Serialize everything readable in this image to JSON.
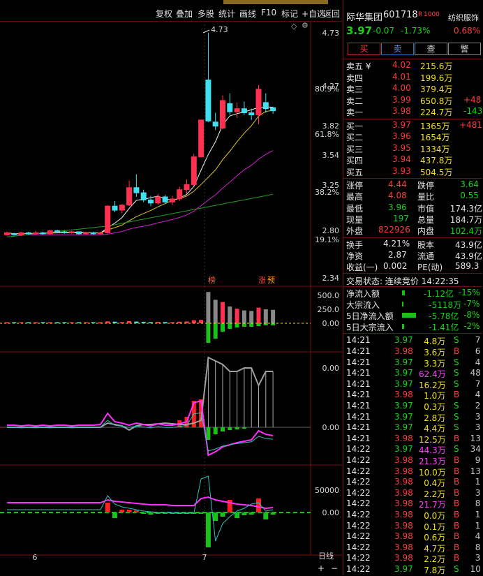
{
  "toolbar": {
    "items": [
      "复权",
      "叠加",
      "多股",
      "统计",
      "画线",
      "F10",
      "标记",
      "+自选",
      "返回"
    ]
  },
  "stock": {
    "name": "际华集团",
    "code": "601718",
    "badge": "R",
    "sector": "纺织服饰",
    "price": "3.97",
    "change": "-0.07",
    "change_pct": "-1.73%",
    "sector_pct": "0.68%"
  },
  "buttons": [
    "买",
    "卖",
    "查",
    "警"
  ],
  "chart_axis": {
    "price_ticks": [
      "4.73",
      "4.27",
      "3.82",
      "3.54",
      "3.25",
      "2.80",
      "2.34"
    ],
    "pct_ticks": [
      "80.9%",
      "61.8%",
      "38.2%",
      "19.1%"
    ],
    "peak_label": "4.73",
    "vol_ticks": [
      "500.0",
      "250.0",
      "0.00"
    ],
    "ind1_ticks": [
      "0.00",
      "0.00"
    ],
    "ind2_ticks": [
      "50000",
      "0.00"
    ],
    "dates": [
      "6",
      "7"
    ],
    "period": "日线",
    "tags": [
      "榜",
      "涨",
      "预"
    ]
  },
  "sell_orders": [
    {
      "label": "卖五 ¥",
      "price": "4.02",
      "vol": "215.6万",
      "delta": ""
    },
    {
      "label": "卖四",
      "price": "4.01",
      "vol": "199.6万",
      "delta": ""
    },
    {
      "label": "卖三",
      "price": "4.00",
      "vol": "379.4万",
      "delta": ""
    },
    {
      "label": "卖二",
      "price": "3.99",
      "vol": "650.8万",
      "delta": "+48"
    },
    {
      "label": "卖一",
      "price": "3.98",
      "vol": "224.7万",
      "delta": "-143"
    }
  ],
  "buy_orders": [
    {
      "label": "买一",
      "price": "3.97",
      "vol": "1365万",
      "delta": "+481"
    },
    {
      "label": "买二",
      "price": "3.96",
      "vol": "1654万",
      "delta": ""
    },
    {
      "label": "买三",
      "price": "3.95",
      "vol": "1334万",
      "delta": ""
    },
    {
      "label": "买四",
      "price": "3.94",
      "vol": "437.8万",
      "delta": ""
    },
    {
      "label": "买五",
      "price": "3.93",
      "vol": "504.5万",
      "delta": ""
    }
  ],
  "stats": [
    {
      "l1": "涨停",
      "v1": "4.44",
      "l2": "跌停",
      "v2": "3.64",
      "c1": "red",
      "c2": "green"
    },
    {
      "l1": "最高",
      "v1": "4.08",
      "l2": "量比",
      "v2": "0.55",
      "c1": "red",
      "c2": "green"
    },
    {
      "l1": "最低",
      "v1": "3.96",
      "l2": "市值",
      "v2": "174.3亿",
      "c1": "green",
      "c2": "white"
    },
    {
      "l1": "现量",
      "v1": "197",
      "l2": "总量",
      "v2": "184.7万",
      "c1": "green",
      "c2": "white"
    },
    {
      "l1": "外盘",
      "v1": "822926",
      "l2": "内盘",
      "v2": "102.4万",
      "c1": "red",
      "c2": "green"
    }
  ],
  "stats2": [
    {
      "l1": "换手",
      "v1": "4.21%",
      "l2": "股本",
      "v2": "43.9亿"
    },
    {
      "l1": "净资",
      "v1": "2.87",
      "l2": "流通",
      "v2": "43.9亿"
    },
    {
      "l1": "收益(一)",
      "v1": "0.002",
      "l2": "PE(动)",
      "v2": "589.3"
    }
  ],
  "trade_status": "交易状态: 连续竞价 14:22:35",
  "flows": [
    {
      "label": "净流入额",
      "v": "-1.12亿",
      "p": "-15%",
      "bar": 4
    },
    {
      "label": "大宗流入",
      "v": "-5118万",
      "p": "-7%",
      "bar": 2
    },
    {
      "label": "5日净流入额",
      "v": "-5.78亿",
      "p": "-8%",
      "bar": 20
    },
    {
      "label": "5日大宗流入",
      "v": "-1.41亿",
      "p": "-2%",
      "bar": 3
    }
  ],
  "ticks": [
    {
      "t": "14:21",
      "p": "3.97",
      "v": "4.8万",
      "s": "S",
      "n": "7",
      "vc": "yellow"
    },
    {
      "t": "14:21",
      "p": "3.98",
      "v": "3.6万",
      "s": "B",
      "n": "6",
      "vc": "yellow"
    },
    {
      "t": "14:21",
      "p": "3.97",
      "v": "3.3万",
      "s": "S",
      "n": "4",
      "vc": "yellow"
    },
    {
      "t": "14:21",
      "p": "3.97",
      "v": "62.4万",
      "s": "S",
      "n": "48",
      "vc": "mag"
    },
    {
      "t": "14:21",
      "p": "3.97",
      "v": "16.2万",
      "s": "S",
      "n": "7",
      "vc": "yellow"
    },
    {
      "t": "14:21",
      "p": "3.98",
      "v": "1.0万",
      "s": "B",
      "n": "4",
      "vc": "yellow"
    },
    {
      "t": "14:21",
      "p": "3.97",
      "v": "0.3万",
      "s": "S",
      "n": "2",
      "vc": "yellow"
    },
    {
      "t": "14:21",
      "p": "3.97",
      "v": "2.8万",
      "s": "S",
      "n": "3",
      "vc": "yellow"
    },
    {
      "t": "14:21",
      "p": "3.97",
      "v": "4.4万",
      "s": "S",
      "n": "3",
      "vc": "yellow"
    },
    {
      "t": "14:21",
      "p": "3.98",
      "v": "12.5万",
      "s": "B",
      "n": "13",
      "vc": "yellow"
    },
    {
      "t": "14:22",
      "p": "3.97",
      "v": "44.3万",
      "s": "S",
      "n": "34",
      "vc": "mag"
    },
    {
      "t": "14:22",
      "p": "3.98",
      "v": "21.3万",
      "s": "B",
      "n": "9",
      "vc": "mag"
    },
    {
      "t": "14:22",
      "p": "3.98",
      "v": "10.0万",
      "s": "B",
      "n": "13",
      "vc": "yellow"
    },
    {
      "t": "14:22",
      "p": "3.98",
      "v": "0.4万",
      "s": "B",
      "n": "1",
      "vc": "yellow"
    },
    {
      "t": "14:22",
      "p": "3.98",
      "v": "2.2万",
      "s": "B",
      "n": "3",
      "vc": "yellow"
    },
    {
      "t": "14:22",
      "p": "3.98",
      "v": "21.7万",
      "s": "B",
      "n": "8",
      "vc": "mag"
    },
    {
      "t": "14:22",
      "p": "3.98",
      "v": "0.0万",
      "s": "B",
      "n": "1",
      "vc": "yellow"
    },
    {
      "t": "14:22",
      "p": "3.98",
      "v": "0.1万",
      "s": "B",
      "n": "1",
      "vc": "yellow"
    },
    {
      "t": "14:22",
      "p": "3.98",
      "v": "0.6万",
      "s": "B",
      "n": "4",
      "vc": "yellow"
    },
    {
      "t": "14:22",
      "p": "3.98",
      "v": "4.7万",
      "s": "B",
      "n": "8",
      "vc": "yellow"
    },
    {
      "t": "14:22",
      "p": "3.98",
      "v": "2.2万",
      "s": "B",
      "n": "3",
      "vc": "yellow"
    },
    {
      "t": "14:22",
      "p": "3.97",
      "v": "7.8万",
      "s": "S",
      "n": "10",
      "vc": "yellow"
    }
  ],
  "candles": [
    {
      "o": 2.76,
      "c": 2.78,
      "h": 2.79,
      "l": 2.75
    },
    {
      "o": 2.77,
      "c": 2.76,
      "h": 2.78,
      "l": 2.75
    },
    {
      "o": 2.76,
      "c": 2.78,
      "h": 2.79,
      "l": 2.75
    },
    {
      "o": 2.78,
      "c": 2.77,
      "h": 2.79,
      "l": 2.76
    },
    {
      "o": 2.77,
      "c": 2.78,
      "h": 2.8,
      "l": 2.76
    },
    {
      "o": 2.78,
      "c": 2.77,
      "h": 2.79,
      "l": 2.76
    },
    {
      "o": 2.77,
      "c": 2.8,
      "h": 2.81,
      "l": 2.76
    },
    {
      "o": 2.8,
      "c": 2.79,
      "h": 2.81,
      "l": 2.78
    },
    {
      "o": 2.79,
      "c": 2.78,
      "h": 2.8,
      "l": 2.77
    },
    {
      "o": 2.78,
      "c": 2.79,
      "h": 2.8,
      "l": 2.77
    },
    {
      "o": 2.79,
      "c": 2.77,
      "h": 2.79,
      "l": 2.76
    },
    {
      "o": 2.77,
      "c": 2.78,
      "h": 2.79,
      "l": 2.76
    },
    {
      "o": 2.78,
      "c": 2.77,
      "h": 2.79,
      "l": 2.76
    },
    {
      "o": 2.77,
      "c": 2.78,
      "h": 2.79,
      "l": 2.76
    },
    {
      "o": 2.78,
      "c": 3.04,
      "h": 3.05,
      "l": 2.77
    },
    {
      "o": 3.04,
      "c": 3.0,
      "h": 3.09,
      "l": 2.98
    },
    {
      "o": 3.0,
      "c": 3.05,
      "h": 3.06,
      "l": 2.97
    },
    {
      "o": 3.05,
      "c": 3.22,
      "h": 3.29,
      "l": 3.04
    },
    {
      "o": 3.22,
      "c": 3.17,
      "h": 3.35,
      "l": 3.13
    },
    {
      "o": 3.17,
      "c": 3.1,
      "h": 3.2,
      "l": 3.08
    },
    {
      "o": 3.1,
      "c": 3.07,
      "h": 3.14,
      "l": 3.04
    },
    {
      "o": 3.07,
      "c": 3.13,
      "h": 3.16,
      "l": 3.05
    },
    {
      "o": 3.13,
      "c": 3.08,
      "h": 3.15,
      "l": 3.06
    },
    {
      "o": 3.08,
      "c": 3.11,
      "h": 3.14,
      "l": 3.05
    },
    {
      "o": 3.11,
      "c": 3.2,
      "h": 3.23,
      "l": 3.09
    },
    {
      "o": 3.2,
      "c": 3.25,
      "h": 3.3,
      "l": 3.16
    },
    {
      "o": 3.25,
      "c": 3.52,
      "h": 3.55,
      "l": 3.24
    },
    {
      "o": 3.52,
      "c": 3.88,
      "h": 3.88,
      "l": 3.88
    },
    {
      "o": 4.27,
      "c": 3.87,
      "h": 4.73,
      "l": 3.86
    },
    {
      "o": 3.86,
      "c": 3.82,
      "h": 3.95,
      "l": 3.78
    },
    {
      "o": 3.8,
      "c": 4.07,
      "h": 4.12,
      "l": 3.79
    },
    {
      "o": 4.04,
      "c": 3.96,
      "h": 4.14,
      "l": 3.93
    },
    {
      "o": 3.96,
      "c": 3.99,
      "h": 4.05,
      "l": 3.9
    },
    {
      "o": 3.99,
      "c": 3.95,
      "h": 4.06,
      "l": 3.93
    },
    {
      "o": 3.95,
      "c": 3.93,
      "h": 3.99,
      "l": 3.88
    },
    {
      "o": 3.93,
      "c": 4.18,
      "h": 4.22,
      "l": 3.84
    },
    {
      "o": 4.05,
      "c": 3.99,
      "h": 4.14,
      "l": 3.95
    },
    {
      "o": 4.0,
      "c": 3.97,
      "h": 4.01,
      "l": 3.94
    }
  ],
  "volumes": [
    10,
    12,
    11,
    9,
    10,
    12,
    15,
    11,
    10,
    9,
    12,
    11,
    10,
    12,
    35,
    28,
    22,
    40,
    30,
    24,
    20,
    25,
    22,
    20,
    28,
    32,
    55,
    60,
    560,
    420,
    380,
    300,
    260,
    230,
    220,
    280,
    250,
    240
  ]
}
